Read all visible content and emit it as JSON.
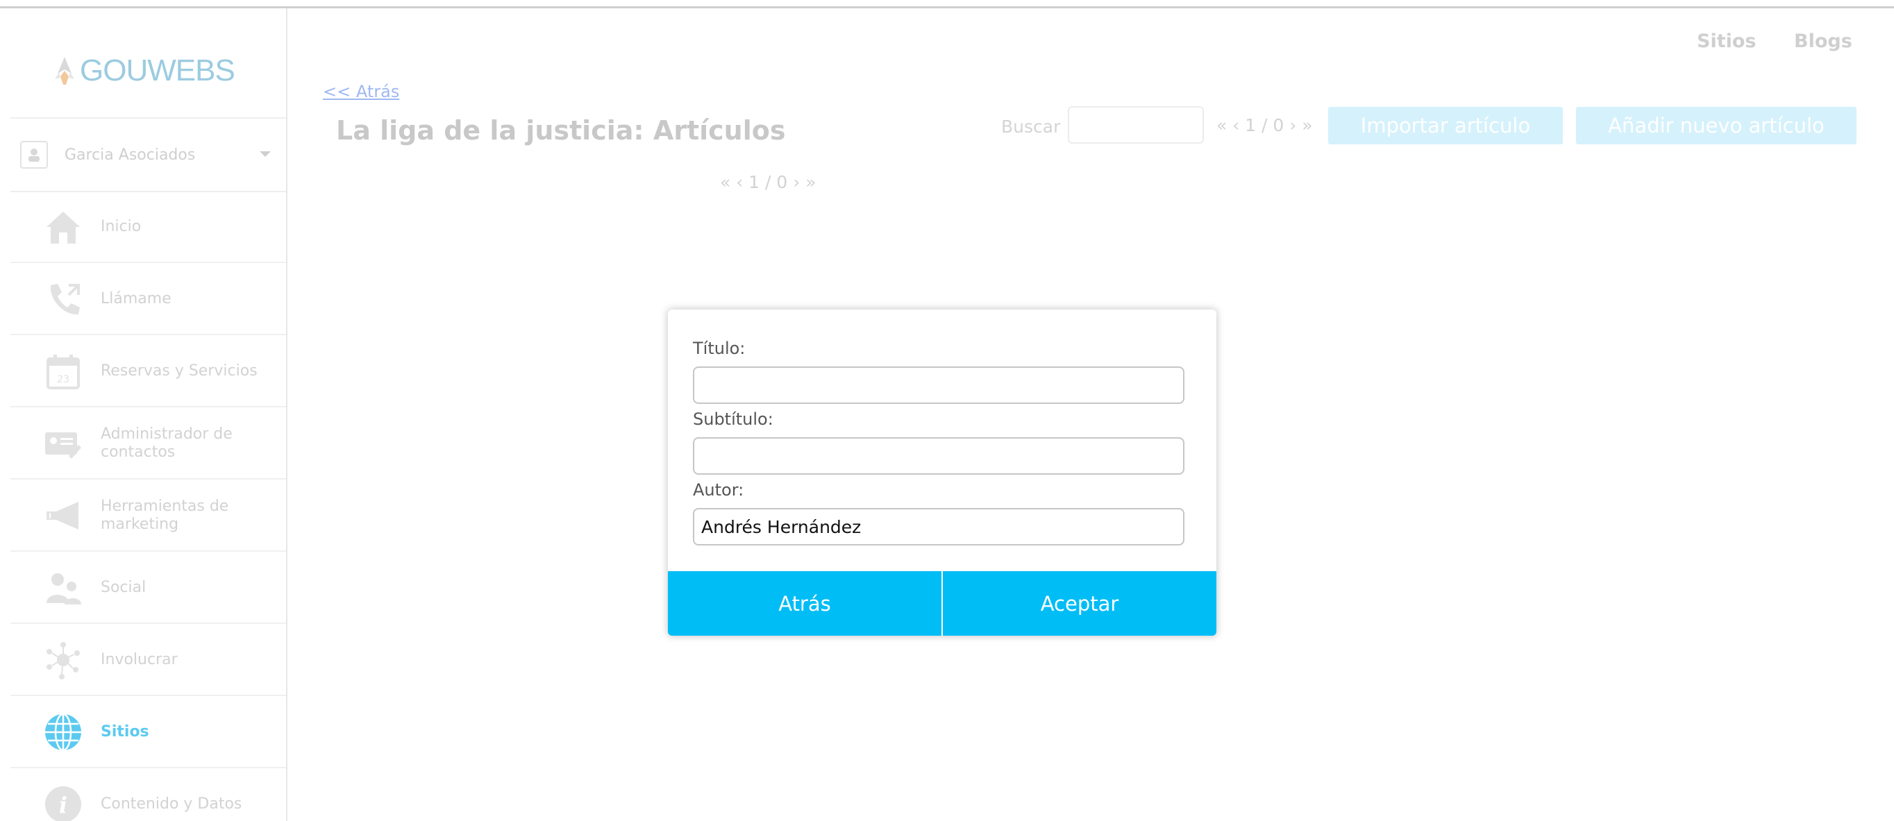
{
  "brand": {
    "logo_text": "GOUWEBS"
  },
  "header": {
    "nav": [
      "Sitios",
      "Blogs"
    ]
  },
  "sidebar": {
    "account_name": "Garcia Asociados",
    "items": [
      {
        "label": "Inicio",
        "icon": "house-icon"
      },
      {
        "label": "Llámame",
        "icon": "phone-icon"
      },
      {
        "label": "Reservas y Servicios",
        "icon": "calendar-icon"
      },
      {
        "label": "Administrador de contactos",
        "icon": "contact-card-icon"
      },
      {
        "label": "Herramientas de marketing",
        "icon": "megaphone-icon"
      },
      {
        "label": "Social",
        "icon": "people-icon"
      },
      {
        "label": "Involucrar",
        "icon": "network-icon"
      },
      {
        "label": "Sitios",
        "icon": "globe-icon",
        "active": true
      },
      {
        "label": "Contenido y Datos",
        "icon": "info-icon"
      }
    ]
  },
  "main": {
    "back_link": "<< Atrás",
    "title": "La liga de la justicia: Artículos",
    "search_label": "Buscar",
    "pager_top": "« ‹ 1 / 0 › »",
    "pager_bottom": "« ‹ 1 / 0 › »",
    "import_button": "Importar artículo",
    "add_button": "Añadir nuevo artículo"
  },
  "modal": {
    "title_label": "Título:",
    "title_value": "",
    "subtitle_label": "Subtítulo:",
    "subtitle_value": "",
    "author_label": "Autor:",
    "author_value": "Andrés Hernández",
    "back_button": "Atrás",
    "accept_button": "Aceptar"
  },
  "colors": {
    "accent": "#00bdf6",
    "accent_faded": "#d5f1fc",
    "active_nav": "#5ccaf0",
    "link": "#9fb8f2"
  }
}
